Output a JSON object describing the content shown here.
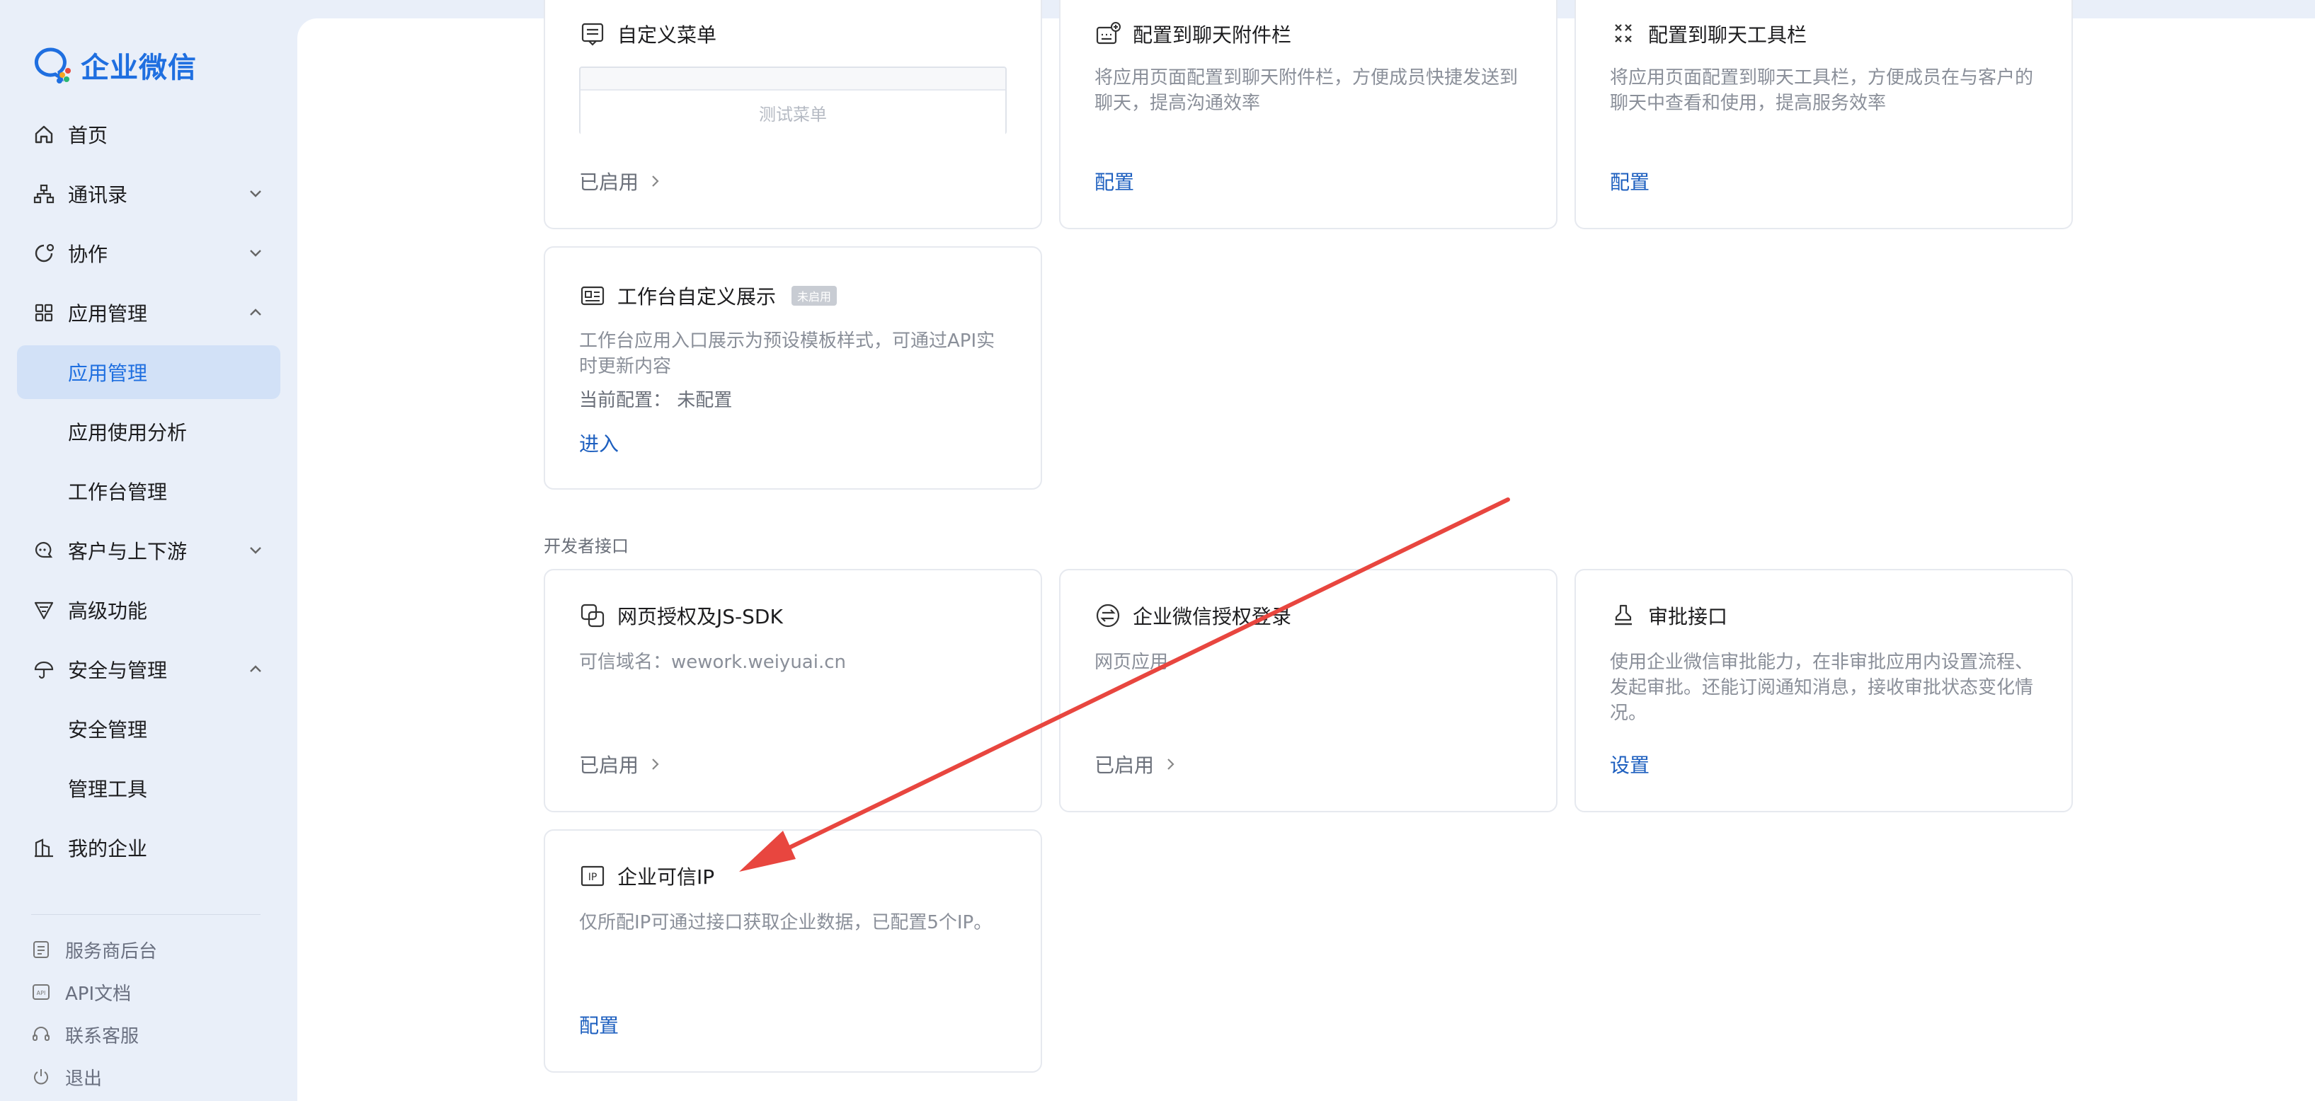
{
  "brand": {
    "name": "企业微信"
  },
  "nav": {
    "home": "首页",
    "contacts": "通讯录",
    "collab": "协作",
    "app_mgmt": "应用管理",
    "app_mgmt_sub": "应用管理",
    "app_usage": "应用使用分析",
    "workbench": "工作台管理",
    "customers": "客户与上下游",
    "advanced": "高级功能",
    "security": "安全与管理",
    "security_sub": "安全管理",
    "tools": "管理工具",
    "my_company": "我的企业"
  },
  "footer": {
    "provider": "服务商后台",
    "api_docs": "API文档",
    "support": "联系客服",
    "logout": "退出"
  },
  "cards_top": {
    "custom_menu": {
      "title": "自定义菜单",
      "preview": "测试菜单",
      "status": "已启用"
    },
    "chat_attach": {
      "title": "配置到聊天附件栏",
      "desc": "将应用页面配置到聊天附件栏，方便成员快捷发送到聊天，提高沟通效率",
      "link": "配置"
    },
    "chat_toolbar": {
      "title": "配置到聊天工具栏",
      "desc": "将应用页面配置到聊天工具栏，方便成员在与客户的聊天中查看和使用，提高服务效率",
      "link": "配置"
    },
    "workbench_custom": {
      "title": "工作台自定义展示",
      "badge": "未启用",
      "desc": "工作台应用入口展示为预设模板样式，可通过API实时更新内容",
      "config": "当前配置： 未配置",
      "link": "进入"
    }
  },
  "section": {
    "dev_api": "开发者接口"
  },
  "cards_dev": {
    "web_auth": {
      "title": "网页授权及JS-SDK",
      "desc": "可信域名：wework.weiyuai.cn",
      "status": "已启用"
    },
    "wecom_login": {
      "title": "企业微信授权登录",
      "desc": "网页应用",
      "status": "已启用"
    },
    "approval": {
      "title": "审批接口",
      "desc": "使用企业微信审批能力，在非审批应用内设置流程、发起审批。还能订阅通知消息，接收审批状态变化情况。",
      "link": "设置"
    },
    "trusted_ip": {
      "title": "企业可信IP",
      "desc": "仅所配IP可通过接口获取企业数据，已配置5个IP。",
      "link": "配置"
    }
  },
  "colors": {
    "accent": "#1f6fe0",
    "link": "#1d5fbf",
    "arrow": "#e8463f"
  }
}
